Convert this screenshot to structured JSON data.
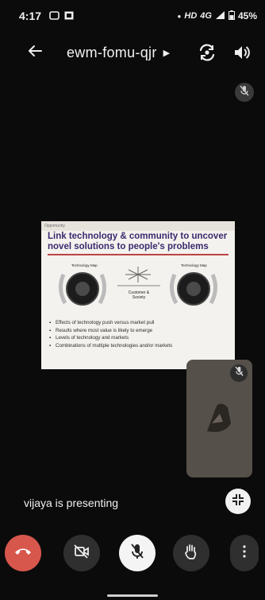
{
  "status_bar": {
    "time": "4:17",
    "network": "HD",
    "signal": "4G",
    "battery": "45%"
  },
  "header": {
    "meeting_code": "ewm-fomu-qjr"
  },
  "slide": {
    "header_text": "Opportunity",
    "title": "Link technology & community to uncover novel solutions to people's problems",
    "left_label": "Technology Map",
    "center_label": "Customer & Society",
    "right_label": "Technology Map",
    "bullets": [
      "Effects of technology push versus market pull",
      "Results where most value is likely to emerge",
      "Levels of technology and markets",
      "Combinations of multiple technologies and/or markets"
    ]
  },
  "presenting_text": "vijaya is presenting",
  "colors": {
    "end_call": "#d7574d",
    "background": "#0b0b0b",
    "slide_title": "#3b2a6e"
  }
}
